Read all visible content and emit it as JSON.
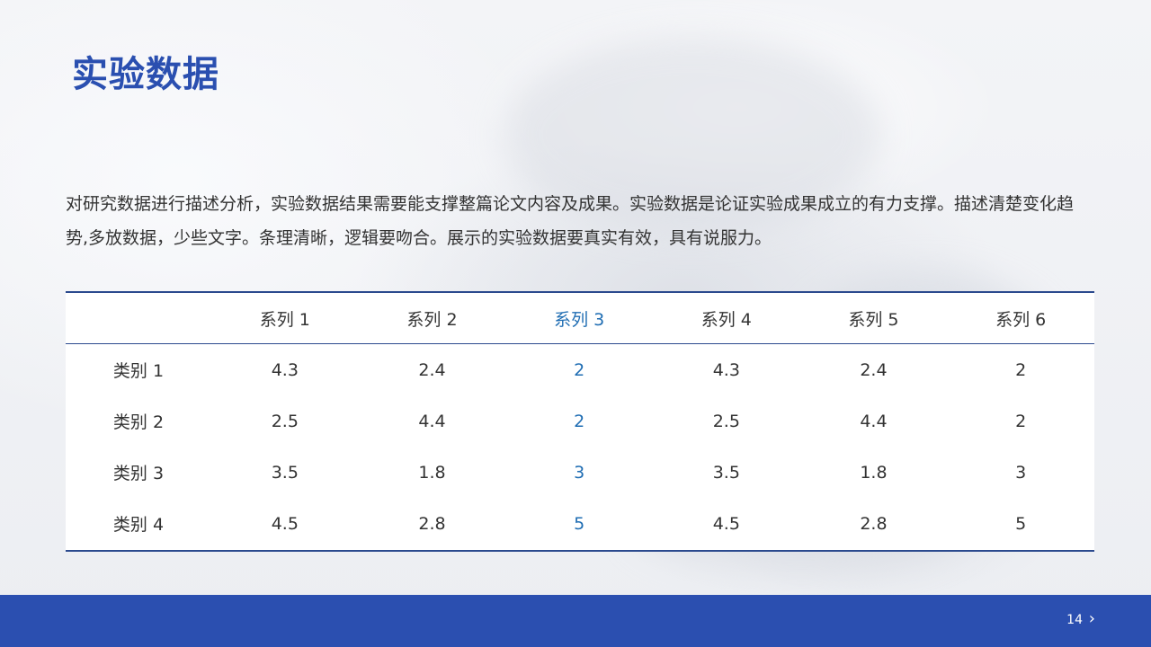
{
  "slide": {
    "title": "实验数据",
    "description": "对研究数据进行描述分析，实验数据结果需要能支撑整篇论文内容及成果。实验数据是论证实验成果成立的有力支撑。描述清楚变化趋势,多放数据，少些文字。条理清晰，逻辑要吻合。展示的实验数据要真实有效，具有说服力。"
  },
  "table": {
    "corner": "",
    "columns": [
      "系列 1",
      "系列 2",
      "系列 3",
      "系列 4",
      "系列 5",
      "系列 6"
    ],
    "rows": [
      {
        "label": "类别 1",
        "values": [
          "4.3",
          "2.4",
          "2",
          "4.3",
          "2.4",
          "2"
        ]
      },
      {
        "label": "类别 2",
        "values": [
          "2.5",
          "4.4",
          "2",
          "2.5",
          "4.4",
          "2"
        ]
      },
      {
        "label": "类别 3",
        "values": [
          "3.5",
          "1.8",
          "3",
          "3.5",
          "1.8",
          "3"
        ]
      },
      {
        "label": "类别 4",
        "values": [
          "4.5",
          "2.8",
          "5",
          "4.5",
          "2.8",
          "5"
        ]
      }
    ],
    "highlight_column_color": "#1f6db3"
  },
  "footer": {
    "page_number": "14",
    "next_icon": "chevron-right-icon",
    "bar_color": "#2b4fb0"
  },
  "colors": {
    "title": "#2a4fb0",
    "table_border": "#2b4a8e"
  }
}
